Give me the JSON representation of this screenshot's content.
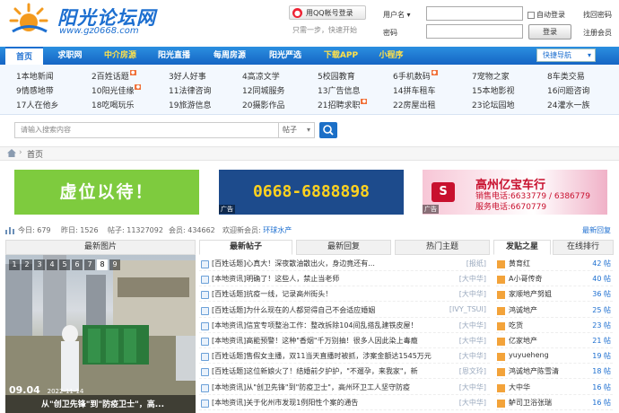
{
  "header": {
    "site_title": "阳光论坛网",
    "site_url": "www.gz0668.com",
    "qq_login": "用QQ帐号登录",
    "qq_note": "只需一步，快速开始",
    "user_label": "用户名",
    "pwd_label": "密码",
    "auto_login": "自动登录",
    "login_button": "登录",
    "find_password": "找回密码",
    "register": "注册会员"
  },
  "nav": {
    "items": [
      "首页",
      "求职网",
      "中介房源",
      "阳光直播",
      "每周房源",
      "阳光严选",
      "下载APP",
      "小程序"
    ],
    "quick_nav": "快捷导航"
  },
  "subnav": {
    "rows": [
      [
        "1本地新闻",
        "2百姓话题",
        "3好人好事",
        "4高凉文学",
        "5校园教育",
        "6手机数码",
        "7宠物之家",
        "8车类交易"
      ],
      [
        "9情感地带",
        "10阳光佳缘",
        "11法律咨询",
        "12同城服务",
        "13广告信息",
        "14拼车租车",
        "15本地影视",
        "16问题咨询"
      ],
      [
        "17人在他乡",
        "18吃喝玩乐",
        "19旅游信息",
        "20摄影作品",
        "21招聘求职",
        "22房屋出租",
        "23论坛园地",
        "24灌水一族"
      ]
    ]
  },
  "search": {
    "placeholder": "请输入搜索内容",
    "type": "帖子"
  },
  "breadcrumb": "首页",
  "ads": {
    "ad1": "虚位以待！",
    "ad2": "0668-6888898",
    "ad_tag": "广告",
    "ad3_logo": "S",
    "ad3_title": "高州亿宝车行",
    "ad3_line1": "销售电话:6633779 / 6386779",
    "ad3_line2": "服务电话:6670779"
  },
  "stats": {
    "today": "今日: 679",
    "yesterday": "昨日: 1526",
    "posts": "帖子: 11327092",
    "members": "会员: 434662",
    "welcome": "欢迎新会员:",
    "new_member": "环球水产",
    "new_reply": "最新回复"
  },
  "panels": {
    "latest_photos": "最新图片",
    "tabs": [
      "最新帖子",
      "最新回复",
      "热门主题"
    ],
    "rank_tabs": [
      "发贴之星",
      "在线排行"
    ]
  },
  "photo": {
    "pages": [
      "1",
      "2",
      "3",
      "4",
      "5",
      "6",
      "7",
      "8",
      "9"
    ],
    "date": "09.04",
    "date2": "2022-11-14",
    "caption": "从\"创卫先锋\"到\"防疫卫士\"，高..."
  },
  "posts": [
    {
      "cat": "[百姓话题]",
      "title": "心真大！深夜散油散出火，身边竟还有...",
      "src": "[报纸]"
    },
    {
      "cat": "[本地资讯]",
      "title": "明确了！这些人，禁止当老师",
      "src": "[大中华]"
    },
    {
      "cat": "[百姓话题]",
      "title": "抗疫一线，记录高州街头！",
      "src": "[大中华]"
    },
    {
      "cat": "[百姓话题]",
      "title": "为什么现在的人都觉得自己不会适应婚姻",
      "src": "[IVY_TSUI]"
    },
    {
      "cat": "[本地资讯]",
      "title": "信宜专项整治工作：整改拆除104间乱搭乱建铁皮屋！",
      "src": "[大中华]"
    },
    {
      "cat": "[本地资讯]",
      "title": "高能预警！这种\"香烟\"千万别抽！很多人因此染上毒瘾",
      "src": "[大中华]"
    },
    {
      "cat": "[百姓话题]",
      "title": "售假女主播，双11当天直播时被抓，涉案金额达1545万元",
      "src": "[大中华]"
    },
    {
      "cat": "[百姓话题]",
      "title": "这位新娘火了！结婚前夕护护，\"不遛孕，来我家\"，新",
      "src": "[恩文玲]"
    },
    {
      "cat": "[本地资讯]",
      "title": "从\"创卫先锋\"到\"防疫卫士\"，高州环卫工人坚守防疫",
      "src": "[大中华]"
    },
    {
      "cat": "[本地资讯]",
      "title": "关于化州市发现1例阳性个案的通告",
      "src": "[大中华]"
    }
  ],
  "rank": [
    {
      "name": "黄育红",
      "count": "42 帖"
    },
    {
      "name": "A小哥传奇",
      "count": "40 帖"
    },
    {
      "name": "家顺地产努姐",
      "count": "36 帖"
    },
    {
      "name": "鸿诚地产",
      "count": "25 帖"
    },
    {
      "name": "吃货",
      "count": "23 帖"
    },
    {
      "name": "亿家地产",
      "count": "21 帖"
    },
    {
      "name": "yuyueheng",
      "count": "19 帖"
    },
    {
      "name": "鸿诚地产陈雪清",
      "count": "18 帖"
    },
    {
      "name": "大中华",
      "count": "16 帖"
    },
    {
      "name": "鲈司卫浴张瑞",
      "count": "16 帖"
    }
  ],
  "colors": {
    "brand": "#1d6fd0",
    "nav": "#1565c4",
    "accent": "#f3a33a",
    "highlight": "#ffe14a"
  }
}
